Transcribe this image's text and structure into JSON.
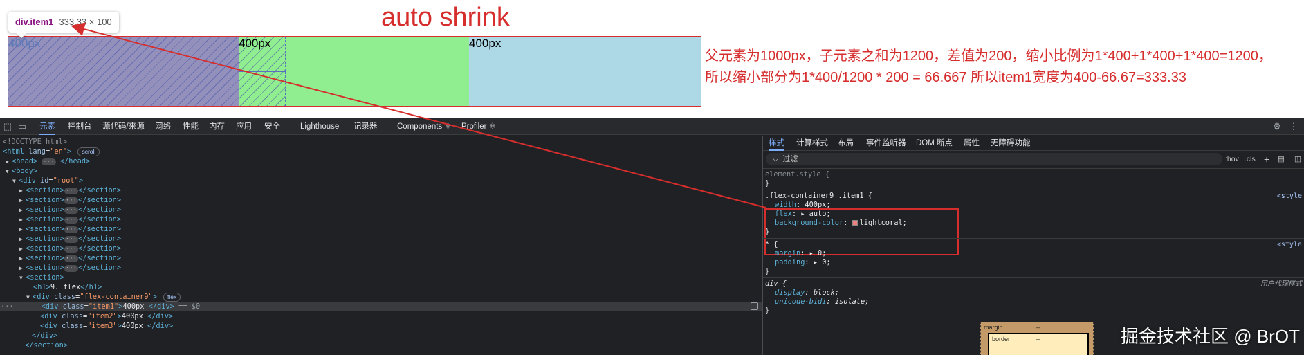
{
  "demo": {
    "title": "auto shrink",
    "tooltip": {
      "name": "div.item1",
      "dims": "333.33 × 100"
    },
    "items": [
      "400px",
      "400px",
      "400px"
    ],
    "explanation": [
      "父元素为1000px，子元素之和为1200，差值为200，缩小比例为1*400+1*400+1*400=1200，",
      "所以缩小部分为1*400/1200 * 200 = 66.667 所以item1宽度为400-66.67=333.33"
    ],
    "colors": {
      "item1": "#f08080",
      "item2": "#90ee90",
      "item3": "#add8e6",
      "annotation": "#d62d2d"
    }
  },
  "devtools": {
    "toolbar_icons": [
      "inspect-icon",
      "device-toggle-icon"
    ],
    "tabs": [
      "元素",
      "控制台",
      "源代码/来源",
      "网络",
      "性能",
      "内存",
      "应用",
      "安全",
      "Lighthouse",
      "记录器",
      "Components ⚛",
      "Profiler ⚛"
    ],
    "active_tab": "元素",
    "elements": {
      "doctype": "<!DOCTYPE html>",
      "html_open": {
        "tag": "<html",
        "attr": "lang",
        "val": "\"en\"",
        "close": ">",
        "badge": "scroll"
      },
      "head": {
        "open": "<head>",
        "close": "</head>"
      },
      "body_open": "<body>",
      "root": {
        "tag": "<div",
        "attr": "id",
        "val": "\"root\"",
        "close": ">"
      },
      "sections": [
        "<section>",
        "<section>",
        "<section>",
        "<section>",
        "<section>",
        "<section>",
        "<section>",
        "<section>",
        "<section>"
      ],
      "section_close": "</section>",
      "section_open": "<section>",
      "h1": {
        "open": "<h1>",
        "text": "9. flex",
        "close": "</h1>"
      },
      "container": {
        "tag": "<div",
        "attr": "class",
        "val": "\"flex-container9\"",
        "close": ">",
        "badge": "flex"
      },
      "children": [
        {
          "tag": "<div",
          "attr": "class",
          "val": "\"item1\"",
          "text": "400px",
          "close": "</div>",
          "suffix": "== $0"
        },
        {
          "tag": "<div",
          "attr": "class",
          "val": "\"item2\"",
          "text": "400px",
          "close": "</div>",
          "suffix": ""
        },
        {
          "tag": "<div",
          "attr": "class",
          "val": "\"item3\"",
          "text": "400px",
          "close": "</div>",
          "suffix": ""
        }
      ],
      "div_close": "</div>",
      "section_close_last": "</section>"
    },
    "styles_tabs": [
      "样式",
      "计算样式",
      "布局",
      "事件监听器",
      "DOM 断点",
      "属性",
      "无障碍功能"
    ],
    "active_styles_tab": "样式",
    "filter_placeholder": "过滤",
    "filter_buttons": [
      ":hov",
      ".cls"
    ],
    "rules": {
      "element_style": "element.style {",
      "close": "}",
      "r1": {
        "selector": ".flex-container9 .item1 {",
        "source": "<style",
        "props": [
          {
            "name": "width",
            "value": "400px;"
          },
          {
            "name": "flex",
            "value": "▸ auto;"
          },
          {
            "name": "background-color",
            "value": "lightcoral;"
          }
        ]
      },
      "r2": {
        "selector": "* {",
        "source": "<style",
        "props": [
          {
            "name": "margin",
            "value": "▸ 0;"
          },
          {
            "name": "padding",
            "value": "▸ 0;"
          }
        ]
      },
      "r3": {
        "selector": "div {",
        "source": "用户代理样式",
        "props": [
          {
            "name": "display",
            "value": "block;"
          },
          {
            "name": "unicode-bidi",
            "value": "isolate;"
          }
        ]
      }
    },
    "box_model": {
      "margin_label": "margin",
      "margin_value": "–",
      "border_label": "border",
      "border_value": "–"
    }
  },
  "watermark": "掘金技术社区 @ BrOT"
}
